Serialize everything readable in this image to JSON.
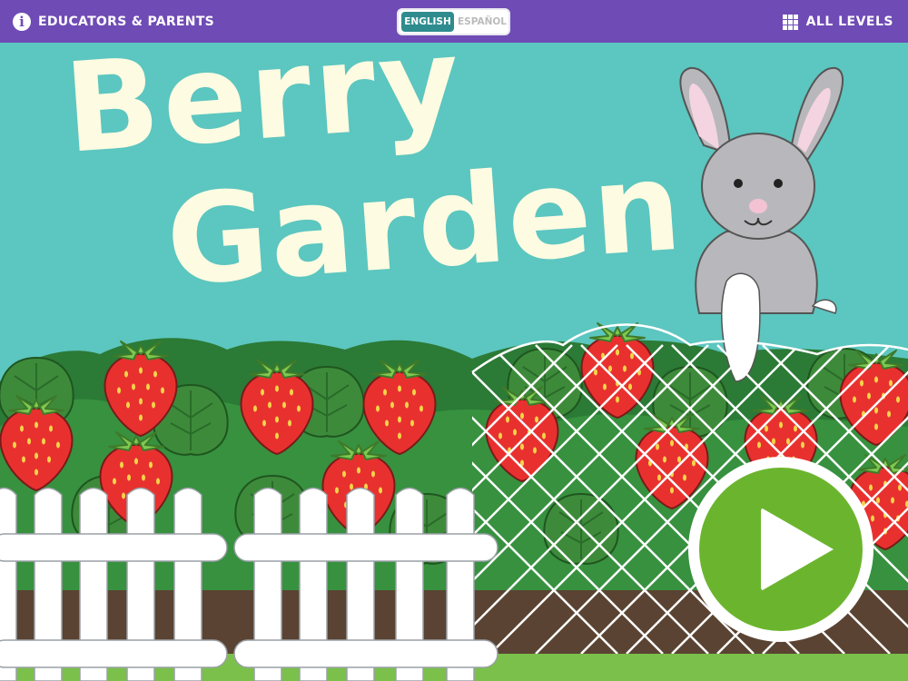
{
  "topbar": {
    "educators_label": "EDUCATORS & PARENTS",
    "lang_english": "ENGLISH",
    "lang_spanish": "ESPAÑOL",
    "all_levels_label": "ALL LEVELS"
  },
  "title": {
    "line1": "Berry",
    "line2": "Garden"
  },
  "icons": {
    "info": "info-icon",
    "grid": "grid-icon",
    "play": "play-icon"
  },
  "colors": {
    "topbar": "#6f4bb5",
    "sky": "#5cc6c0",
    "title": "#fdfbe1",
    "play": "#6bb52e",
    "strawberry": "#e8312f",
    "leaf": "#4a9a3d"
  }
}
